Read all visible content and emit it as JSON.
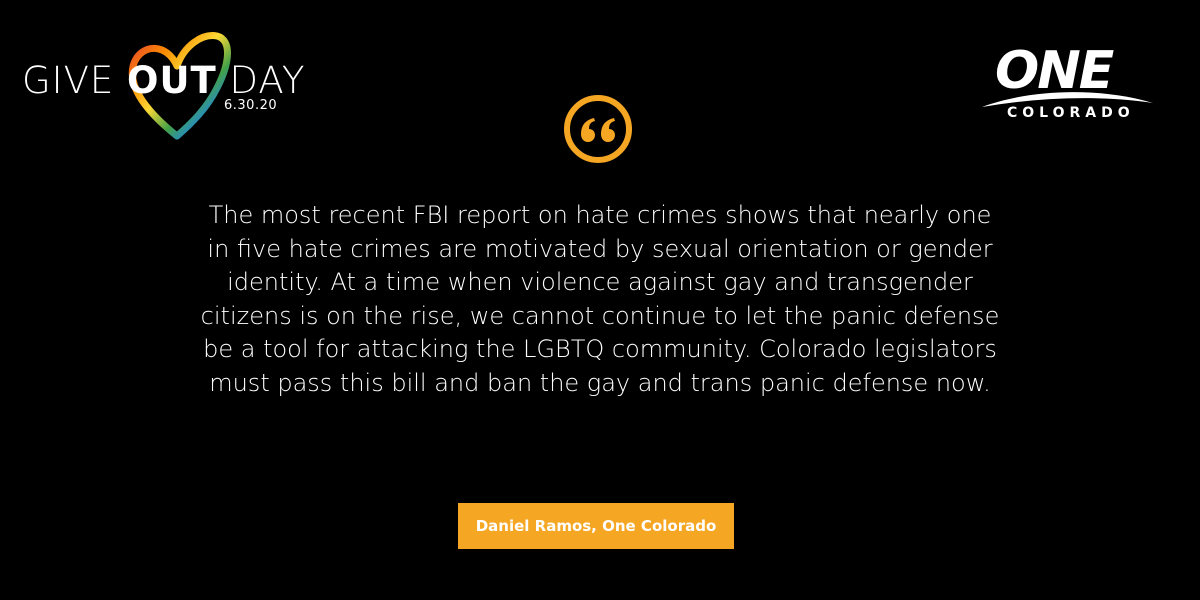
{
  "left_logo": {
    "word_give": "GIVE ",
    "word_out": "OUT",
    "word_day": " DAY",
    "date": "6.30.20"
  },
  "right_logo": {
    "name": "ONE",
    "sub": "COLORADO"
  },
  "quote_icon": "quotation-mark-icon",
  "quote": {
    "text": "The most recent FBI report on hate crimes shows that nearly one in five hate crimes are motivated by sexual orientation or gender identity. At a time when violence against gay and transgender citizens is on the rise, we cannot continue to let the panic defense be a tool for attacking the LGBTQ community. Colorado legislators must pass this bill and ban the gay and trans panic defense now."
  },
  "attribution": "Daniel Ramos, One Colorado",
  "colors": {
    "background": "#000000",
    "accent": "#f5a623",
    "text": "#ffffff"
  }
}
